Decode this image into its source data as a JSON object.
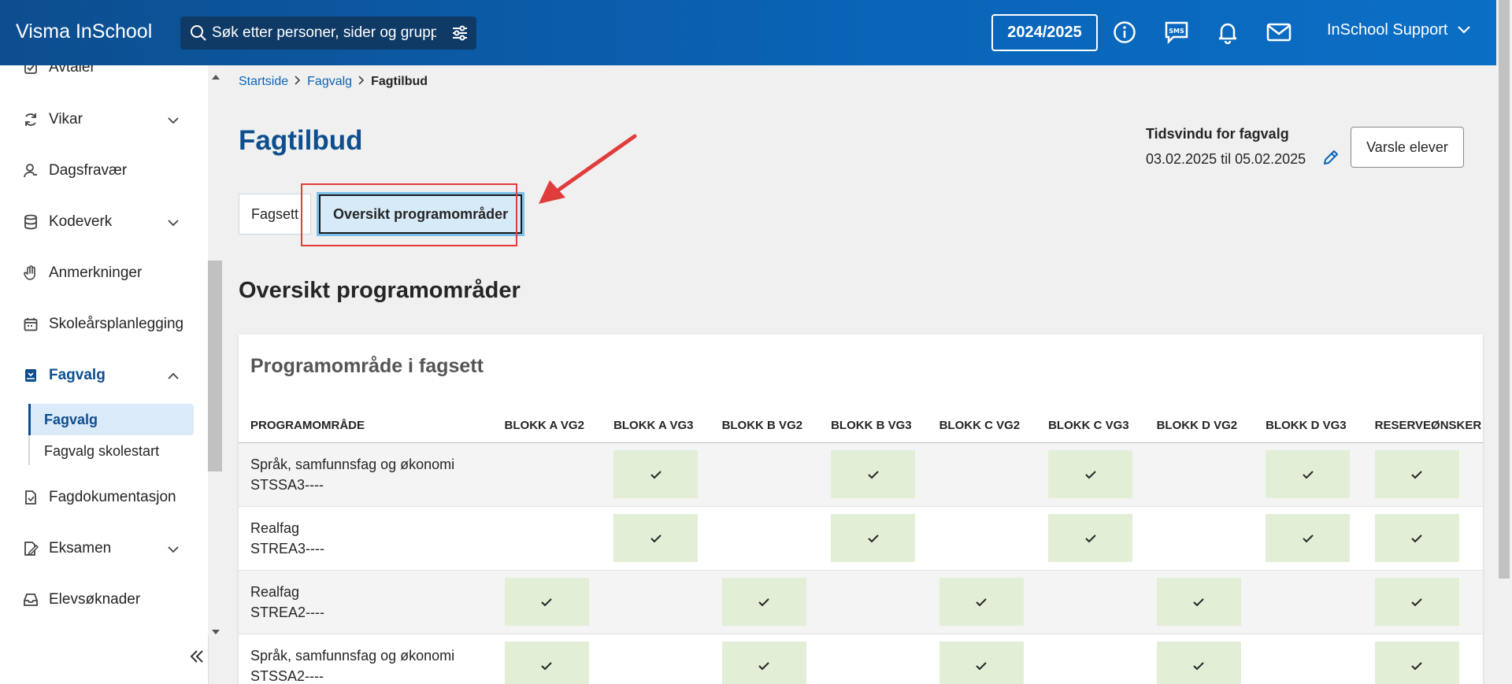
{
  "topbar": {
    "brand": "Visma InSchool",
    "search_placeholder": "Søk etter personer, sider og grupper",
    "school_year": "2024/2025",
    "user_name": "InSchool Support"
  },
  "sidebar": {
    "items": [
      {
        "label": "Avtaler",
        "icon": "checkbox-icon"
      },
      {
        "label": "Vikar",
        "icon": "refresh-icon",
        "expandable": true
      },
      {
        "label": "Dagsfravær",
        "icon": "person-icon"
      },
      {
        "label": "Kodeverk",
        "icon": "database-icon",
        "expandable": true
      },
      {
        "label": "Anmerkninger",
        "icon": "hand-icon"
      },
      {
        "label": "Skoleårsplanlegging",
        "icon": "calendar-icon"
      },
      {
        "label": "Fagvalg",
        "icon": "bookmark-icon",
        "expandable": true,
        "expanded": true
      },
      {
        "label": "Fagdokumentasjon",
        "icon": "document-icon"
      },
      {
        "label": "Eksamen",
        "icon": "exam-icon",
        "expandable": true
      },
      {
        "label": "Elevsøknader",
        "icon": "inbox-icon"
      }
    ],
    "subitems": [
      {
        "label": "Fagvalg",
        "active": true
      },
      {
        "label": "Fagvalg skolestart",
        "active": false
      }
    ]
  },
  "breadcrumb": [
    "Startside",
    "Fagvalg",
    "Fagtilbud"
  ],
  "page": {
    "title": "Fagtilbud",
    "time_window_label": "Tidsvindu for fagvalg",
    "time_window_value": "03.02.2025 til 05.02.2025",
    "notify_button": "Varsle elever"
  },
  "tabs": [
    {
      "label": "Fagsett",
      "active": false
    },
    {
      "label": "Oversikt programområder",
      "active": true
    }
  ],
  "section_title": "Oversikt programområder",
  "card": {
    "title": "Programområde i fagsett",
    "columns": [
      "PROGRAMOMRÅDE",
      "BLOKK A VG2",
      "BLOKK A VG3",
      "BLOKK B VG2",
      "BLOKK B VG3",
      "BLOKK C VG2",
      "BLOKK C VG3",
      "BLOKK D VG2",
      "BLOKK D VG3",
      "RESERVEØNSKER"
    ],
    "rows": [
      {
        "name": "Språk, samfunnsfag og økonomi",
        "code": "STSSA3----",
        "checks": [
          false,
          true,
          false,
          true,
          false,
          true,
          false,
          true,
          true
        ]
      },
      {
        "name": "Realfag",
        "code": "STREA3----",
        "checks": [
          false,
          true,
          false,
          true,
          false,
          true,
          false,
          true,
          true
        ]
      },
      {
        "name": "Realfag",
        "code": "STREA2----",
        "checks": [
          true,
          false,
          true,
          false,
          true,
          false,
          true,
          false,
          true
        ]
      },
      {
        "name": "Språk, samfunnsfag og økonomi",
        "code": "STSSA2----",
        "checks": [
          true,
          false,
          true,
          false,
          true,
          false,
          true,
          false,
          true
        ]
      }
    ]
  },
  "colors": {
    "topbar": "#0a63b6",
    "accent": "#0d4e8f",
    "check_bg": "#e2efd6",
    "highlight": "#e03c3c"
  }
}
